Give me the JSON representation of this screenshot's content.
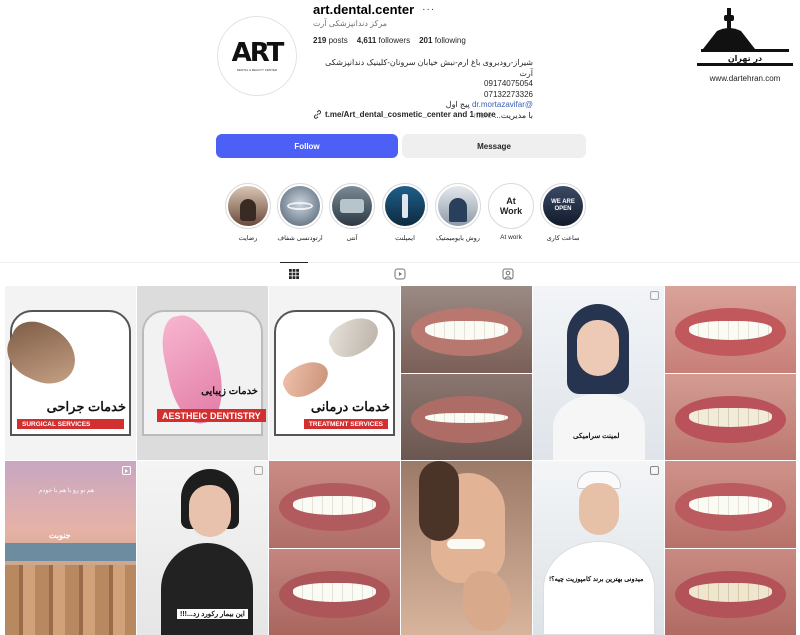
{
  "profile": {
    "username": "art.dental.center",
    "more_icon": "ellipsis-icon",
    "category": "مرکز دندانپزشکی آرت",
    "avatar_mark": "ART",
    "avatar_sub": "DENTAL & BEAUTY CENTER",
    "stats": {
      "posts_count": "219",
      "posts_label": "posts",
      "followers_count": "4,611",
      "followers_label": "followers",
      "following_count": "201",
      "following_label": "following"
    },
    "bio": {
      "line1": "شیراز-رودبروی باغ ارم-نبش خیابان سرونان-کلینیک دندانپزشکی آرت",
      "line2": "09174075054",
      "line3": "07132273326",
      "line4_prefix": "پیج اول",
      "line4_mention": "dr.mortazavifar@",
      "line5": "...با مدیریت",
      "line5_more": "more"
    },
    "link": "t.me/Art_dental_cosmetic_center and 1 more"
  },
  "actions": {
    "follow_label": "Follow",
    "message_label": "Message"
  },
  "highlights": [
    {
      "label": "رضایت"
    },
    {
      "label": "ارتودنسی شفاف"
    },
    {
      "label": "آنتی"
    },
    {
      "label": "ایمپلنت"
    },
    {
      "label": "روش بایومیمتیک"
    },
    {
      "label": "At work",
      "cover_text": "At Work"
    },
    {
      "label": "ساعت کاری",
      "cover_text": "WE ARE OPEN"
    }
  ],
  "tabs": [
    {
      "name": "posts",
      "icon": "grid-icon",
      "active": true
    },
    {
      "name": "reels",
      "icon": "reels-icon",
      "active": false
    },
    {
      "name": "tagged",
      "icon": "tagged-icon",
      "active": false
    }
  ],
  "posts": {
    "surgical": {
      "title": "خدمات جراحی",
      "bar": "SURGICAL SERVICES"
    },
    "cosmetic": {
      "title": "خدمات زیبایی",
      "bar": "AESTHEIC DENTISTRY"
    },
    "treatment": {
      "title": "خدمات درمانی",
      "bar": "TREATMENT SERVICES"
    },
    "laminate": {
      "caption": "لمینت سرامیکی"
    },
    "travel": {
      "caption": "جنوبت",
      "top_text": "هم تو رو با هم با خودم"
    },
    "patient": {
      "caption": "این بیمار رکورد زد...!!!"
    },
    "brand": {
      "caption": "میدونی بهترین برند کامپوزیت چیه؟!"
    }
  },
  "watermark": {
    "logo_text": "در تهران",
    "url": "www.dartehran.com"
  },
  "colors": {
    "follow_button": "#4c60f5",
    "message_button": "#efefef",
    "service_bar": "#d23030",
    "mention": "#3b5fb8"
  }
}
